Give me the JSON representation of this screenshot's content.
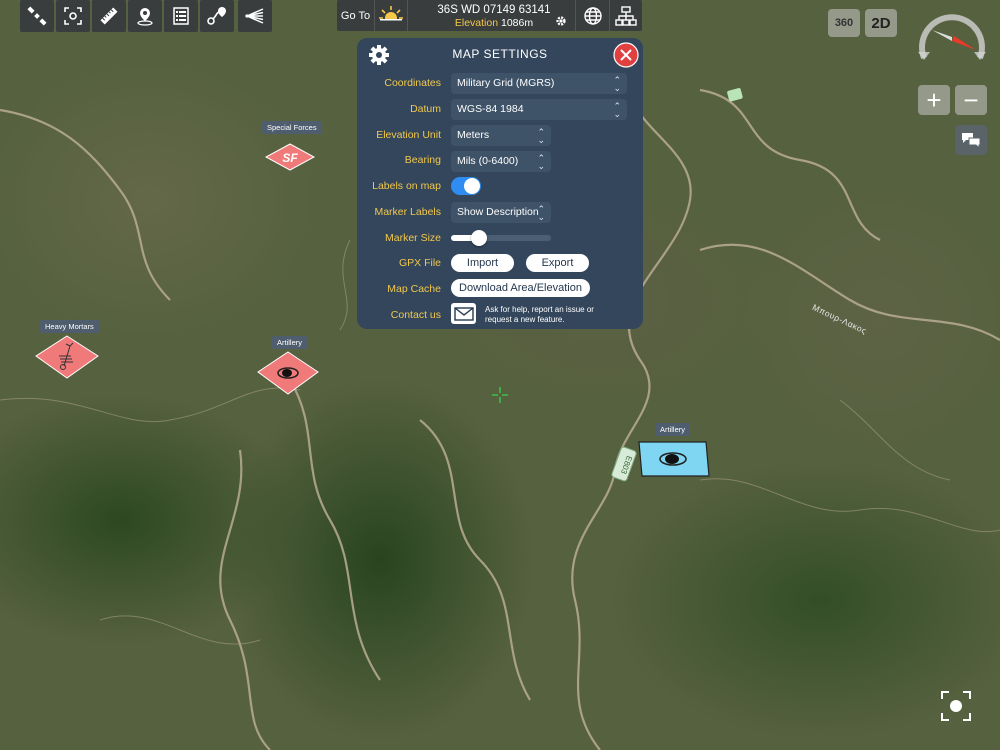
{
  "toolbar": {
    "tools": [
      {
        "icon": "satellite-icon"
      },
      {
        "icon": "focus-frame-icon"
      },
      {
        "icon": "ruler-icon"
      },
      {
        "icon": "map-pin-icon"
      },
      {
        "icon": "list-icon"
      },
      {
        "icon": "route-icon"
      },
      {
        "icon": "field-of-view-icon"
      }
    ],
    "goto_label": "Go To",
    "coordinates": "36S WD 07149 63141",
    "elevation_label": "Elevation",
    "elevation_value": "1086m"
  },
  "settings": {
    "title": "MAP SETTINGS",
    "coordinates_label": "Coordinates",
    "coordinates_value": "Military Grid (MGRS)",
    "datum_label": "Datum",
    "datum_value": "WGS-84 1984",
    "elevation_unit_label": "Elevation Unit",
    "elevation_unit_value": "Meters",
    "bearing_label": "Bearing",
    "bearing_value": "Mils (0-6400)",
    "labels_on_map_label": "Labels on map",
    "labels_on_map_on": true,
    "marker_labels_label": "Marker Labels",
    "marker_labels_value": "Show Description",
    "marker_size_label": "Marker Size",
    "marker_size_level": 0.28,
    "gpx_label": "GPX File",
    "import_label": "Import",
    "export_label": "Export",
    "cache_label": "Map Cache",
    "download_label": "Download Area/Elevation",
    "contact_label": "Contact us",
    "contact_text_1": "Ask for help, report an issue or",
    "contact_text_2": "request a new feature."
  },
  "map": {
    "markers": {
      "special_forces": {
        "label": "Special Forces",
        "symbol": "SF"
      },
      "heavy_mortars": {
        "label": "Heavy Mortars"
      },
      "artillery_left": {
        "label": "Artillery"
      },
      "artillery_right": {
        "label": "Artillery"
      }
    },
    "road_sign_1": "E803",
    "place_label": "Μπουρ-Λακος"
  },
  "right_controls": {
    "btn_360": "360",
    "btn_2d": "2D",
    "zoom_in": "+",
    "zoom_out": "−"
  },
  "colors": {
    "panel": "#33465c",
    "accent_label": "#f2c84a",
    "hostile_marker": "#f07a7a",
    "friendly_marker": "#7fd6f2",
    "toggle": "#2f8cf0",
    "close": "#e04040"
  }
}
